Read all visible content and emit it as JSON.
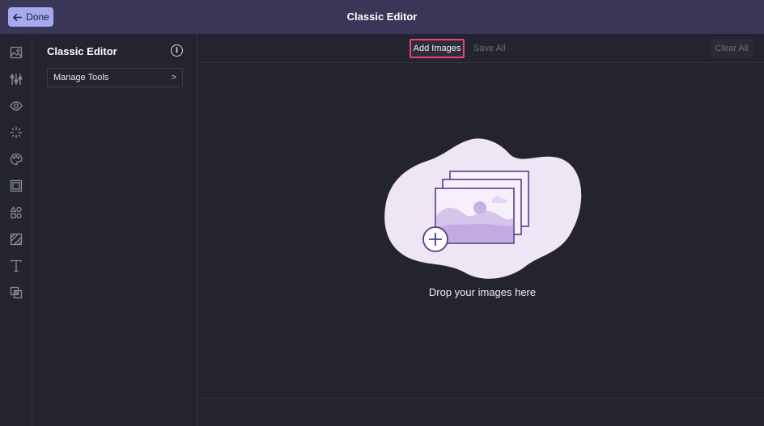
{
  "header": {
    "done_label": "Done",
    "title": "Classic Editor"
  },
  "rail": {
    "icons": [
      "image-icon",
      "adjust-sliders-icon",
      "eye-icon",
      "sparkle-icon",
      "palette-icon",
      "frame-icon",
      "shapes-icon",
      "texture-icon",
      "text-icon",
      "overlay-icon"
    ]
  },
  "panel": {
    "title": "Classic Editor",
    "info_icon": "info-icon",
    "manage_tools_label": "Manage Tools",
    "manage_tools_chevron": ">"
  },
  "toolbar": {
    "add_images_label": "Add Images",
    "save_all_label": "Save All",
    "clear_all_label": "Clear All"
  },
  "dropzone": {
    "text": "Drop your images here",
    "blob_color": "#efe6f5",
    "accent": "#4f3f8e"
  },
  "colors": {
    "header_bg": "#393657",
    "done_bg": "#a6a9ee",
    "highlight": "#e8457f",
    "page_bg": "#23242f"
  }
}
